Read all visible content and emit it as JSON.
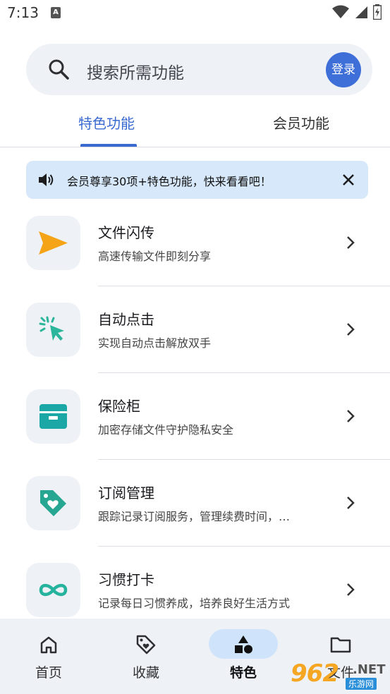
{
  "status_bar": {
    "time": "7:13",
    "notification_glyph": "A"
  },
  "search": {
    "placeholder": "搜索所需功能",
    "login_label": "登录"
  },
  "tabs": [
    {
      "label": "特色功能",
      "active": true
    },
    {
      "label": "会员功能",
      "active": false
    }
  ],
  "banner": {
    "text": "会员尊享30项+特色功能，快来看看吧！"
  },
  "features": [
    {
      "title": "文件闪传",
      "subtitle": "高速传输文件即刻分享",
      "icon": "send-icon",
      "color": "#f5a418"
    },
    {
      "title": "自动点击",
      "subtitle": "实现自动点击解放双手",
      "icon": "auto-click-icon",
      "color": "#2bb59a"
    },
    {
      "title": "保险柜",
      "subtitle": "加密存储文件守护隐私安全",
      "icon": "safe-box-icon",
      "color": "#1aa7a5"
    },
    {
      "title": "订阅管理",
      "subtitle": "跟踪记录订阅服务，管理续费时间，…",
      "icon": "tag-heart-icon",
      "color": "#27a792"
    },
    {
      "title": "习惯打卡",
      "subtitle": "记录每日习惯养成，培养良好生活方式",
      "icon": "infinity-icon",
      "color": "#26b39e"
    }
  ],
  "bottom_nav": [
    {
      "label": "首页",
      "icon": "home-icon",
      "active": false
    },
    {
      "label": "收藏",
      "icon": "tag-icon",
      "active": false
    },
    {
      "label": "特色",
      "icon": "shapes-icon",
      "active": true
    },
    {
      "label": "文件",
      "icon": "folder-icon",
      "active": false
    }
  ],
  "watermark": {
    "number": "962",
    "suffix": ".NET",
    "site": "乐游网"
  },
  "colors": {
    "accent": "#3a6ad0",
    "login": "#3e6fd8",
    "banner_bg": "#d6e8fa",
    "nav_bg": "#eef1f6",
    "pill": "#cfe4fb"
  }
}
